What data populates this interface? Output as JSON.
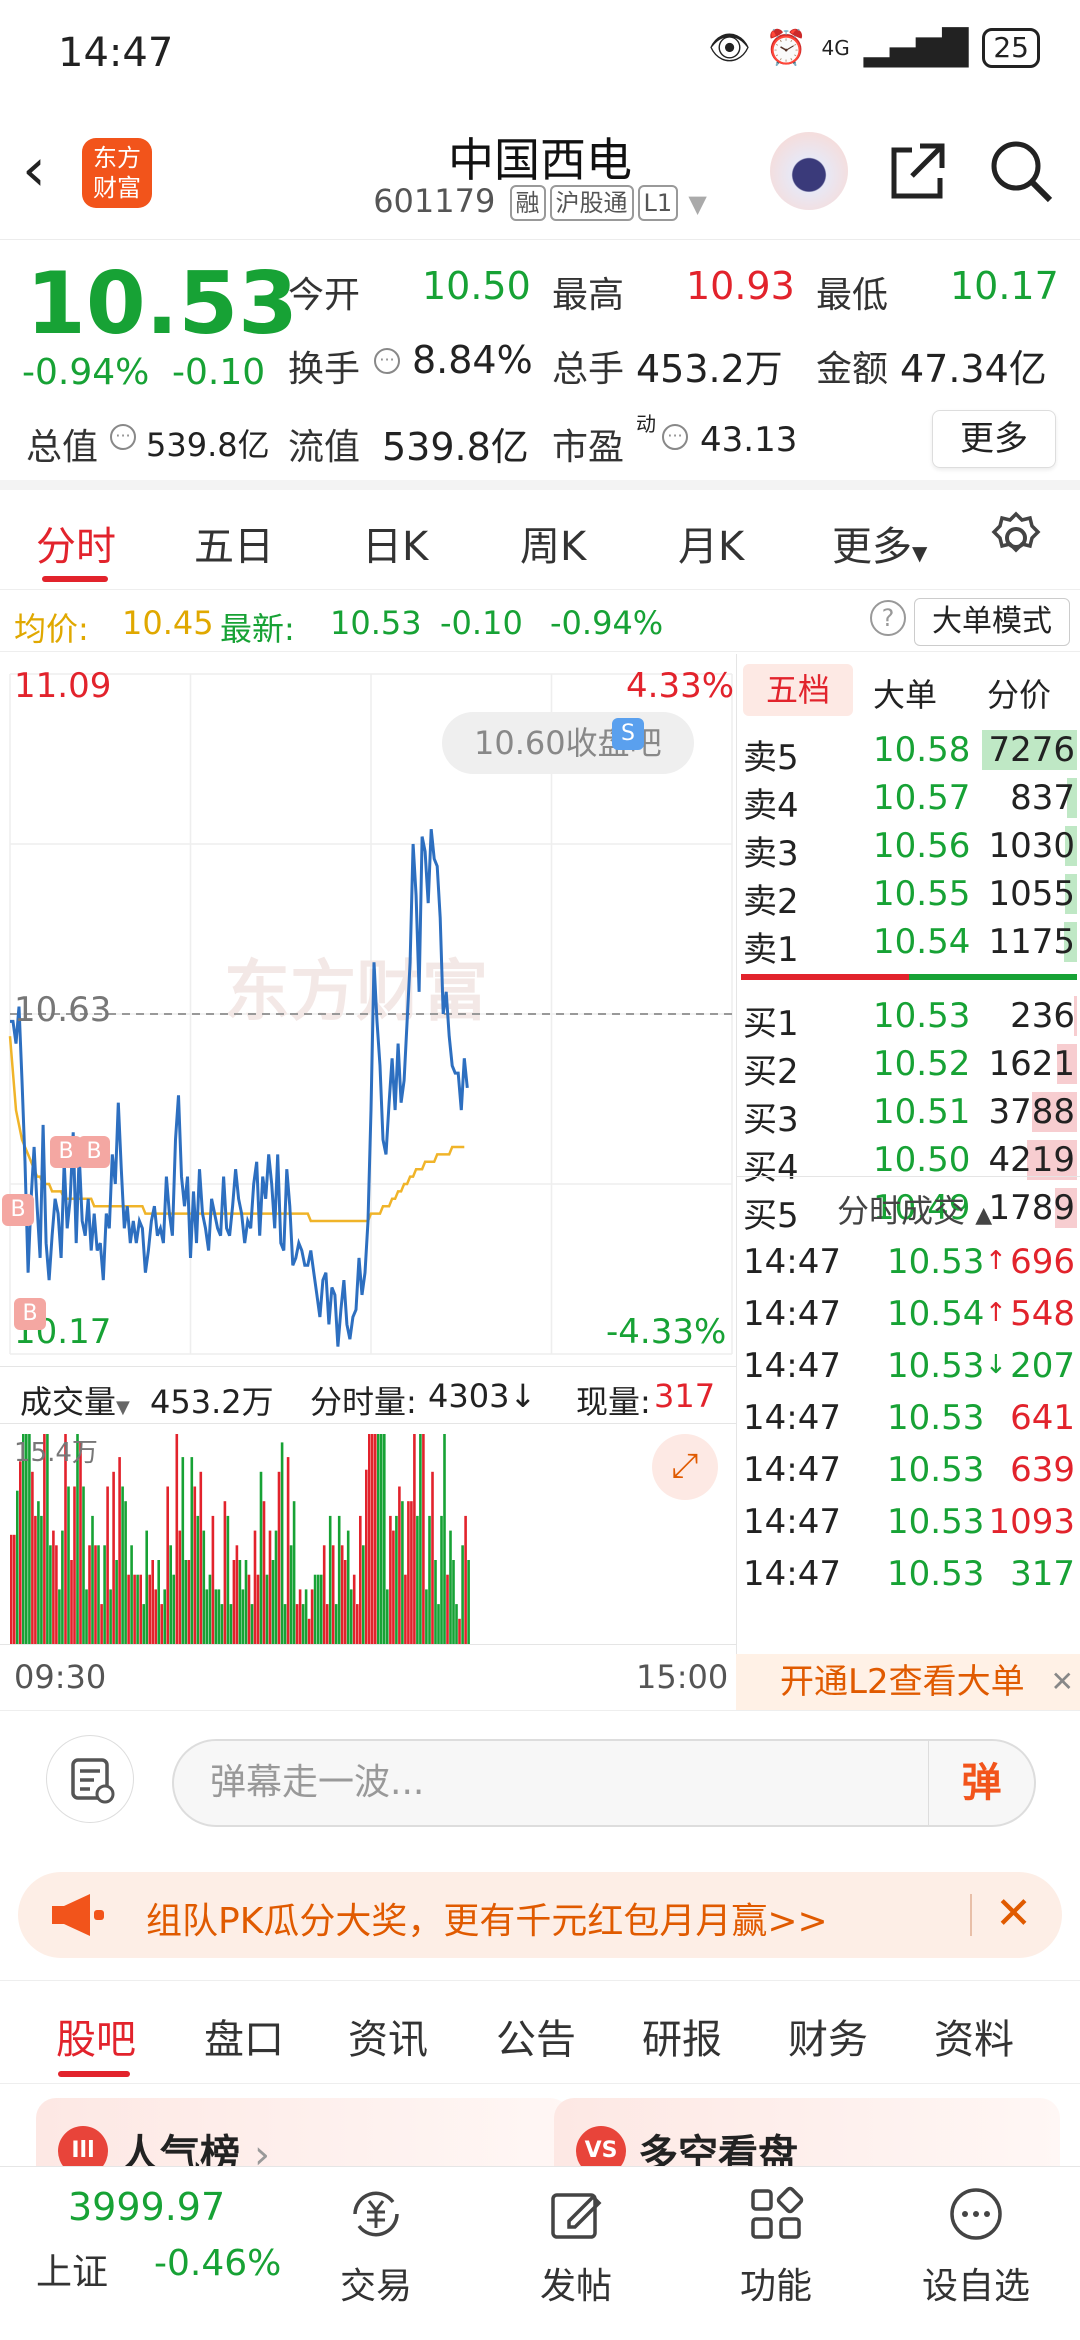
{
  "status_bar": {
    "time": "14:47",
    "network": "4G",
    "battery": "25"
  },
  "header": {
    "logo_line1": "东方",
    "logo_line2": "财富",
    "stock_name": "中国西电",
    "stock_code": "601179",
    "tags": [
      "融",
      "沪股通",
      "L1"
    ]
  },
  "quote": {
    "price": "10.53",
    "pct": "-0.94%",
    "change": "-0.10",
    "open_label": "今开",
    "open": "10.50",
    "high_label": "最高",
    "high": "10.93",
    "low_label": "最低",
    "low": "10.17",
    "turnover_label": "换手",
    "turnover": "8.84%",
    "volume_label": "总手",
    "volume": "453.2万",
    "amount_label": "金额",
    "amount": "47.34亿",
    "total_cap_label": "总值",
    "total_cap": "539.8亿",
    "float_cap_label": "流值",
    "float_cap": "539.8亿",
    "pe_label": "市盈",
    "pe_sup": "动",
    "pe": "43.13",
    "more_label": "更多"
  },
  "chart_tabs": [
    "分时",
    "五日",
    "日K",
    "周K",
    "月K",
    "更多"
  ],
  "avg_bar": {
    "avg_label": "均价:",
    "avg": "10.45",
    "latest_label": "最新:",
    "latest": "10.53",
    "chg": "-0.10",
    "pct": "-0.94%",
    "mode_label": "大单模式"
  },
  "chart_labels": {
    "top_price": "11.09",
    "top_pct": "4.33%",
    "mid_price": "10.63",
    "bottom_price": "10.17",
    "bottom_pct": "-4.33%",
    "bubble": "10.60收盘吧",
    "watermark": "东方财富",
    "vol_label": "成交量",
    "vol_total": "453.2万",
    "tick_vol_label": "分时量:",
    "tick_vol": "4303↓",
    "cur_vol_label": "现量:",
    "cur_vol": "317",
    "vol_max": "15.4万",
    "time_start": "09:30",
    "time_end": "15:00"
  },
  "chart_data": {
    "type": "line",
    "series": [
      {
        "values": [
          10.62,
          10.62,
          10.59,
          10.64,
          10.54,
          10.43,
          10.28,
          10.38,
          10.45,
          10.37,
          10.3,
          10.48,
          10.32,
          10.27,
          10.33,
          10.38,
          10.36,
          10.3,
          10.43,
          10.34,
          10.38,
          10.47,
          10.32,
          10.44,
          10.35,
          10.33,
          10.38,
          10.31,
          10.36,
          10.31,
          10.32,
          10.27,
          10.36,
          10.34,
          10.44,
          10.4,
          10.51,
          10.42,
          10.34,
          10.37,
          10.32,
          10.35,
          10.32,
          10.35,
          10.34,
          10.28,
          10.31,
          10.35,
          10.37,
          10.33,
          10.34,
          10.32,
          10.41,
          10.36,
          10.33,
          10.46,
          10.52,
          10.41,
          10.37,
          10.41,
          10.3,
          10.39,
          10.32,
          10.42,
          10.36,
          10.34,
          10.31,
          10.38,
          10.36,
          10.34,
          10.33,
          10.41,
          10.34,
          10.33,
          10.37,
          10.42,
          10.38,
          10.36,
          10.32,
          10.35,
          10.34,
          10.4,
          10.43,
          10.33,
          10.41,
          10.38,
          10.44,
          10.4,
          10.34,
          10.44,
          10.32,
          10.31,
          10.42,
          10.37,
          10.29,
          10.3,
          10.32,
          10.31,
          10.29,
          10.29,
          10.31,
          10.28,
          10.25,
          10.22,
          10.27,
          10.28,
          10.21,
          10.26,
          10.25,
          10.18,
          10.23,
          10.27,
          10.21,
          10.19,
          10.22,
          10.23,
          10.3,
          10.25,
          10.28,
          10.35,
          10.5,
          10.7,
          10.62,
          10.56,
          10.46,
          10.44,
          10.51,
          10.57,
          10.5,
          10.59,
          10.51,
          10.54,
          10.62,
          10.7,
          10.86,
          10.79,
          10.66,
          10.87,
          10.85,
          10.78,
          10.88,
          10.84,
          10.83,
          10.76,
          10.63,
          10.66,
          10.6,
          10.56,
          10.55,
          10.55,
          10.5,
          10.57,
          10.53
        ]
      },
      {
        "values": [
          10.6,
          10.55,
          10.5,
          10.48,
          10.46,
          10.45,
          10.44,
          10.43,
          10.42,
          10.41,
          10.41,
          10.4,
          10.4,
          10.4,
          10.39,
          10.39,
          10.39,
          10.39,
          10.38,
          10.38,
          10.38,
          10.38,
          10.38,
          10.38,
          10.38,
          10.38,
          10.38,
          10.38,
          10.37,
          10.37,
          10.37,
          10.37,
          10.37,
          10.37,
          10.37,
          10.37,
          10.37,
          10.37,
          10.37,
          10.37,
          10.37,
          10.37,
          10.37,
          10.37,
          10.37,
          10.36,
          10.36,
          10.36,
          10.36,
          10.36,
          10.36,
          10.36,
          10.36,
          10.36,
          10.36,
          10.36,
          10.36,
          10.36,
          10.36,
          10.36,
          10.36,
          10.36,
          10.36,
          10.36,
          10.36,
          10.36,
          10.36,
          10.36,
          10.36,
          10.36,
          10.36,
          10.36,
          10.36,
          10.36,
          10.36,
          10.36,
          10.36,
          10.36,
          10.36,
          10.36,
          10.36,
          10.36,
          10.36,
          10.36,
          10.36,
          10.36,
          10.36,
          10.36,
          10.36,
          10.36,
          10.36,
          10.36,
          10.36,
          10.36,
          10.36,
          10.36,
          10.36,
          10.36,
          10.36,
          10.36,
          10.35,
          10.35,
          10.35,
          10.35,
          10.35,
          10.35,
          10.35,
          10.35,
          10.35,
          10.35,
          10.35,
          10.35,
          10.35,
          10.35,
          10.35,
          10.35,
          10.35,
          10.35,
          10.35,
          10.35,
          10.36,
          10.36,
          10.36,
          10.36,
          10.37,
          10.37,
          10.37,
          10.38,
          10.38,
          10.39,
          10.39,
          10.4,
          10.4,
          10.41,
          10.41,
          10.42,
          10.42,
          10.42,
          10.43,
          10.43,
          10.43,
          10.43,
          10.44,
          10.44,
          10.44,
          10.44,
          10.44,
          10.45,
          10.45,
          10.45,
          10.45,
          10.45
        ]
      }
    ],
    "ylim": [
      10.17,
      11.09
    ],
    "reference": 10.63
  },
  "order_book": {
    "tabs": [
      "五档",
      "大单",
      "分价"
    ],
    "asks": [
      {
        "label": "卖5",
        "price": "10.58",
        "vol": "7276",
        "w": 0.95
      },
      {
        "label": "卖4",
        "price": "10.57",
        "vol": "837",
        "w": 0.1
      },
      {
        "label": "卖3",
        "price": "10.56",
        "vol": "1030",
        "w": 0.12
      },
      {
        "label": "卖2",
        "price": "10.55",
        "vol": "1055",
        "w": 0.12
      },
      {
        "label": "卖1",
        "price": "10.54",
        "vol": "1175",
        "w": 0.13
      }
    ],
    "bids": [
      {
        "label": "买1",
        "price": "10.53",
        "vol": "236",
        "w": 0.03
      },
      {
        "label": "买2",
        "price": "10.52",
        "vol": "1621",
        "w": 0.2
      },
      {
        "label": "买3",
        "price": "10.51",
        "vol": "3788",
        "w": 0.45
      },
      {
        "label": "买4",
        "price": "10.50",
        "vol": "4219",
        "w": 0.5
      },
      {
        "label": "买5",
        "price": "10.49",
        "vol": "1789",
        "w": 0.22
      }
    ],
    "ticks_title": "分时成交",
    "ticks": [
      {
        "time": "14:47",
        "price": "10.53",
        "arrow": "↑",
        "vol": "696",
        "color": "#e2232c"
      },
      {
        "time": "14:47",
        "price": "10.54",
        "arrow": "↑",
        "vol": "548",
        "color": "#e2232c"
      },
      {
        "time": "14:47",
        "price": "10.53",
        "arrow": "↓",
        "vol": "207",
        "color": "#17a235"
      },
      {
        "time": "14:47",
        "price": "10.53",
        "arrow": "",
        "vol": "641",
        "color": "#e2232c"
      },
      {
        "time": "14:47",
        "price": "10.53",
        "arrow": "",
        "vol": "639",
        "color": "#e2232c"
      },
      {
        "time": "14:47",
        "price": "10.53",
        "arrow": "",
        "vol": "1093",
        "color": "#e2232c"
      },
      {
        "time": "14:47",
        "price": "10.53",
        "arrow": "",
        "vol": "317",
        "color": "#17a235"
      }
    ],
    "l2_banner": "开通L2查看大单"
  },
  "danmu": {
    "placeholder": "弹幕走一波...",
    "send": "弹"
  },
  "promo": {
    "text": "组队PK瓜分大奖，更有千元红包月月赢>>"
  },
  "bottom_tabs": [
    "股吧",
    "盘口",
    "资讯",
    "公告",
    "研报",
    "财务",
    "资料"
  ],
  "cards": [
    {
      "title": "人气榜",
      "icon": "Ill"
    },
    {
      "title": "多空看盘",
      "icon": "VS"
    }
  ],
  "bottom_nav": {
    "index_value": "3999.97",
    "index_name": "上证",
    "index_chg": "-0.46%",
    "items": [
      "交易",
      "发帖",
      "功能",
      "设自选"
    ]
  },
  "colors": {
    "up": "#e2232c",
    "down": "#17a235",
    "brand": "#f2541b",
    "line": "#2d6fc0",
    "avg": "#f0b429"
  }
}
